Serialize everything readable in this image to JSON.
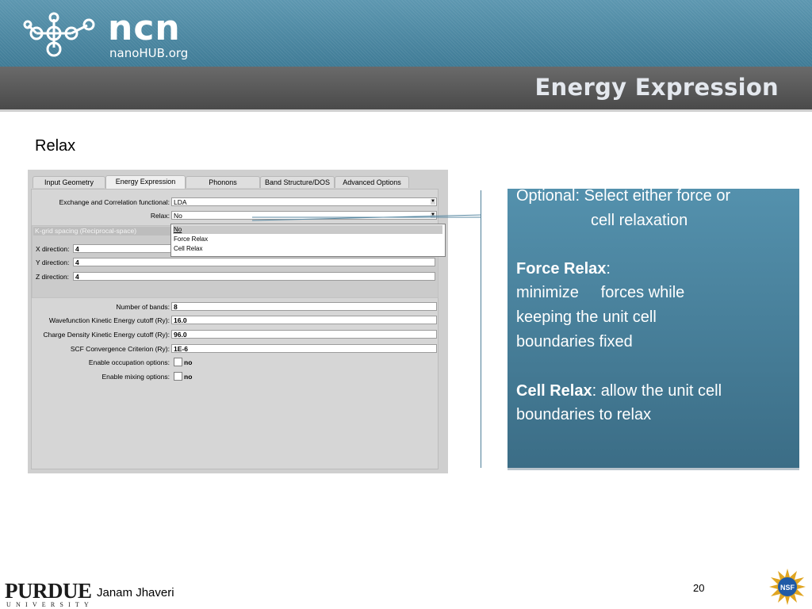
{
  "header": {
    "logo_text": "ncn",
    "logo_sub": "nanoHUB.org",
    "title": "Energy Expression"
  },
  "section_label": "Relax",
  "app": {
    "tabs": [
      {
        "label": "Input Geometry",
        "active": false
      },
      {
        "label": "Energy Expression",
        "active": true
      },
      {
        "label": "Phonons",
        "active": false
      },
      {
        "label": "Band Structure/DOS",
        "active": false
      },
      {
        "label": "Advanced Options",
        "active": false
      }
    ],
    "xc_label": "Exchange and Correlation functional:",
    "xc_value": "LDA",
    "relax_label": "Relax:",
    "relax_value": "No",
    "dropdown_options": [
      "No",
      "Force Relax",
      "Cell Relax"
    ],
    "dropdown_highlighted": "No",
    "kgrid_header": "K-grid spacing (Reciprocal-space)",
    "x_label": "X direction:",
    "x_value": "4",
    "y_label": "Y direction:",
    "y_value": "4",
    "z_label": "Z direction:",
    "z_value": "4",
    "bands_label": "Number of bands:",
    "bands_value": "8",
    "wf_label": "Wavefunction Kinetic Energy cutoff (Ry):",
    "wf_value": "16.0",
    "cd_label": "Charge Density Kinetic Energy cutoff (Ry):",
    "cd_value": "96.0",
    "scf_label": "SCF Convergence Criterion (Ry):",
    "scf_value": "1E-6",
    "occ_label": "Enable occupation options:",
    "occ_value": "no",
    "mix_label": "Enable mixing options:",
    "mix_value": "no"
  },
  "callout": {
    "line1": "Optional: Select either force or",
    "line2": "cell relaxation",
    "force_title": "Force Relax",
    "force_colon": ":",
    "force_line1": "minimize     forces while",
    "force_line2": "keeping the unit cell",
    "force_line3": "boundaries fixed",
    "cell_title": "Cell Relax",
    "cell_rest": ": allow the unit cell",
    "cell_line2": "boundaries to relax"
  },
  "footer": {
    "university": "PURDUE",
    "university_sub": "UNIVERSITY",
    "author": "Janam Jhaveri",
    "page_number": "20"
  },
  "colors": {
    "header_blue": "#4a87a2",
    "title_bar": "#555555",
    "callout_blue": "#4a83a0"
  }
}
